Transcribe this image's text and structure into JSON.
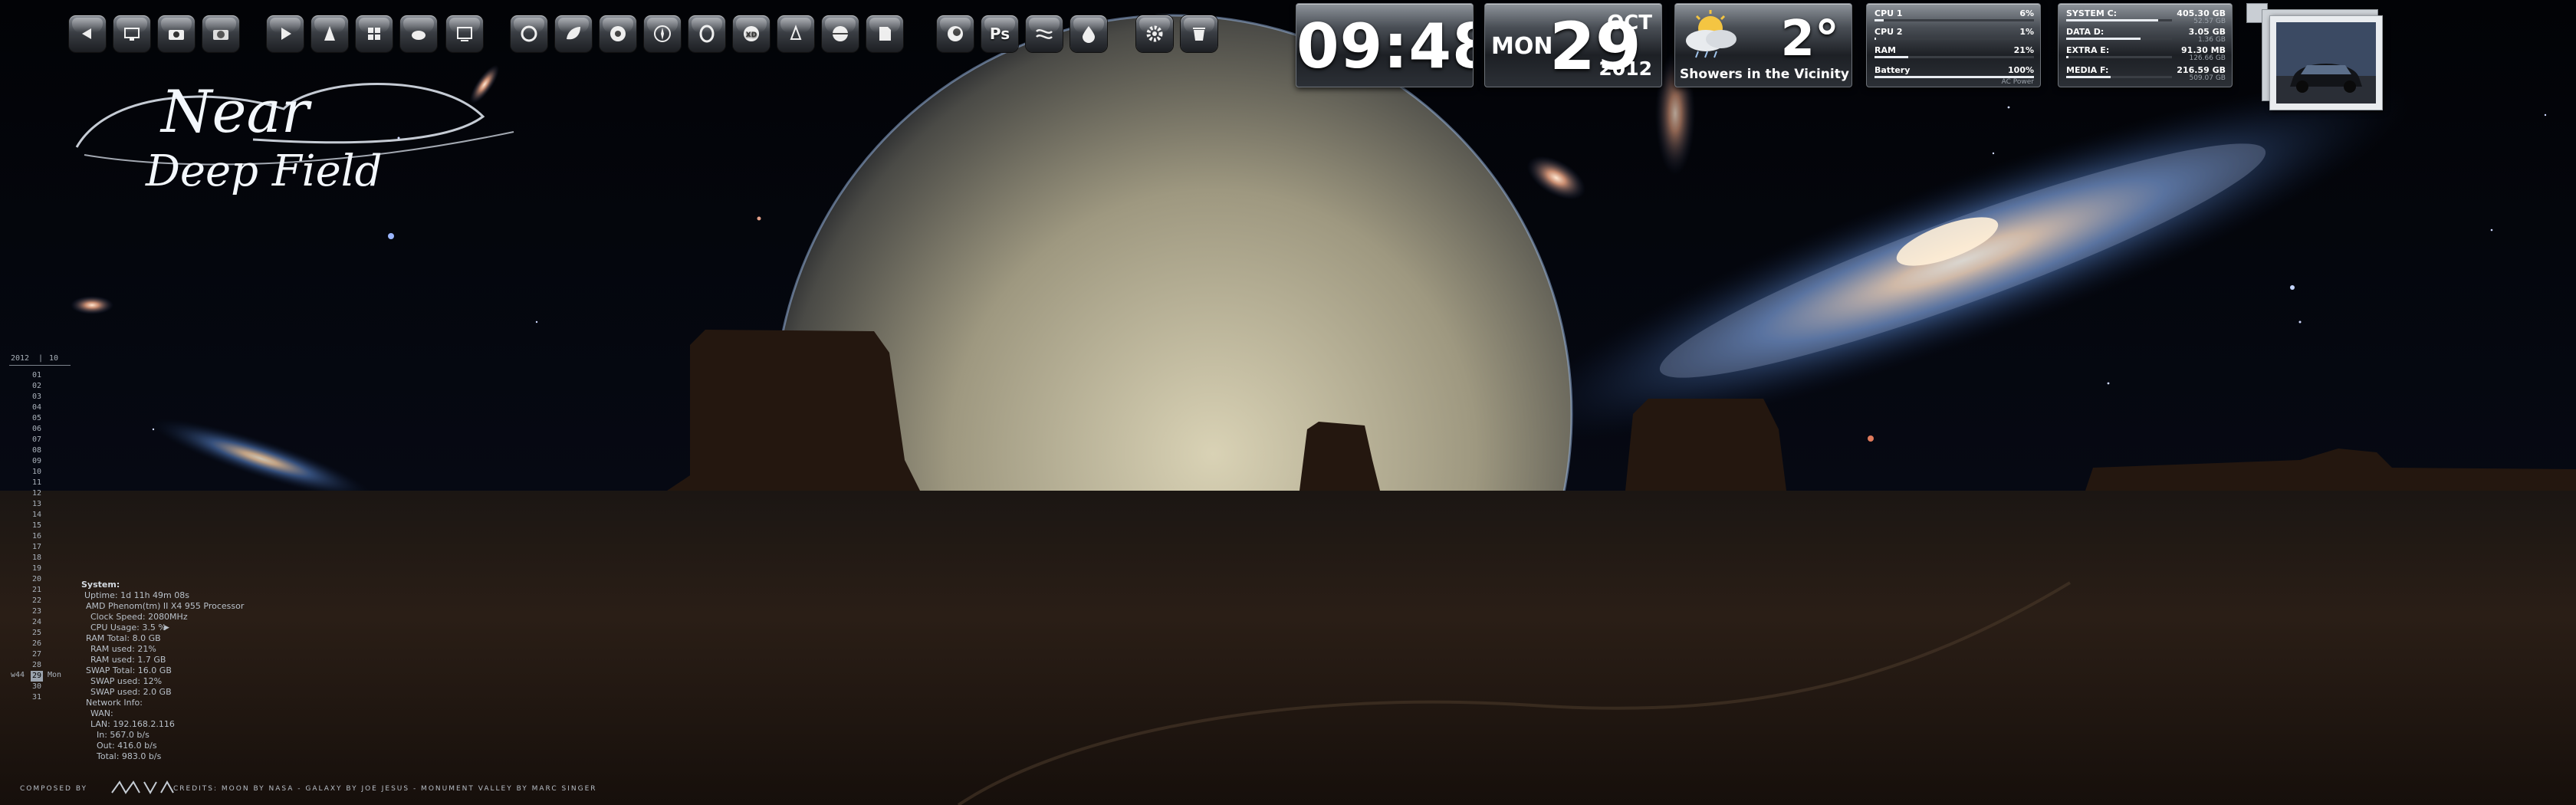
{
  "wallpaper": {
    "logo_text_line1": "Near",
    "logo_text_line2": "Deep Field",
    "credits_left": "COMPOSED BY",
    "credits_right": "CREDITS: MOON BY NASA - GALAXY BY JOE JESUS - MONUMENT VALLEY BY MARC SINGER"
  },
  "dock": {
    "icons": [
      {
        "name": "back-arrow-icon"
      },
      {
        "name": "network-icon"
      },
      {
        "name": "camera-icon"
      },
      {
        "name": "camera-alt-icon"
      },
      {
        "name": "play-icon"
      },
      {
        "name": "vlc-cone-icon"
      },
      {
        "name": "windows-icon"
      },
      {
        "name": "teapot-icon"
      },
      {
        "name": "tv-icon"
      },
      {
        "name": "swirl-icon"
      },
      {
        "name": "leaf-icon"
      },
      {
        "name": "chrome-icon"
      },
      {
        "name": "compass-icon"
      },
      {
        "name": "opera-icon"
      },
      {
        "name": "xd-icon"
      },
      {
        "name": "stamp-icon"
      },
      {
        "name": "sphere-icon"
      },
      {
        "name": "document-icon"
      },
      {
        "name": "cinema4d-icon"
      },
      {
        "name": "photoshop-icon",
        "label": "Ps"
      },
      {
        "name": "wave-icon"
      },
      {
        "name": "drop-icon"
      },
      {
        "name": "gear-icon"
      },
      {
        "name": "recycle-icon"
      }
    ]
  },
  "clock": {
    "time": "09:48"
  },
  "date": {
    "dow": "MON",
    "day": "29",
    "month": "OCT",
    "year": "2012"
  },
  "weather": {
    "temp": "2°",
    "condition": "Showers in the Vicinity",
    "icon": "cloud-sun-rain-icon"
  },
  "system_stats": [
    {
      "label": "CPU 1",
      "value": "6%",
      "level": 0.06
    },
    {
      "label": "CPU 2",
      "value": "1%",
      "level": 0.01
    },
    {
      "label": "RAM",
      "value": "21%",
      "level": 0.21
    },
    {
      "label": "Battery",
      "value": "100%",
      "level": 1.0,
      "sub": "AC Power"
    }
  ],
  "drives": [
    {
      "label": "SYSTEM C:",
      "value": "405.30 GB",
      "sub": "52.57 GB",
      "level": 0.87
    },
    {
      "label": "DATA D:",
      "value": "3.05 GB",
      "sub": "1.36 GB",
      "level": 0.7
    },
    {
      "label": "EXTRA E:",
      "value": "91.30 MB",
      "sub": "126.66 GB",
      "level": 0.02
    },
    {
      "label": "MEDIA F:",
      "value": "216.59 GB",
      "sub": "509.07 GB",
      "level": 0.42
    }
  ],
  "calendar": {
    "year": "2012",
    "month": "10",
    "days": [
      "01",
      "02",
      "03",
      "04",
      "05",
      "06",
      "07",
      "08",
      "09",
      "10",
      "11",
      "12",
      "13",
      "14",
      "15",
      "16",
      "17",
      "18",
      "19",
      "20",
      "21",
      "22",
      "23",
      "24",
      "25",
      "26",
      "27",
      "28",
      "29",
      "30",
      "31"
    ],
    "today": "29",
    "week_label": "w44",
    "today_dow": "Mon"
  },
  "sysinfo": {
    "heading": "System:",
    "uptime": "Uptime: 1d 11h 49m 08s",
    "cpu_model": "AMD Phenom(tm) II X4 955 Processor",
    "clock": "Clock Speed: 2080MHz",
    "cpu_usage": "CPU Usage: 3.5 %",
    "ram_total": "RAM Total: 8.0 GB",
    "ram_used_pct": "RAM used: 21%",
    "ram_used": "RAM used: 1.7 GB",
    "swap_total": "SWAP Total: 16.0 GB",
    "swap_used_pct": "SWAP used: 12%",
    "swap_used": "SWAP used: 2.0 GB",
    "network_heading": "Network Info:",
    "wan": "WAN:",
    "lan": "LAN: 192.168.2.116",
    "in": "In: 567.0 b/s",
    "out": "Out: 416.0 b/s",
    "total": "Total: 983.0 b/s"
  }
}
